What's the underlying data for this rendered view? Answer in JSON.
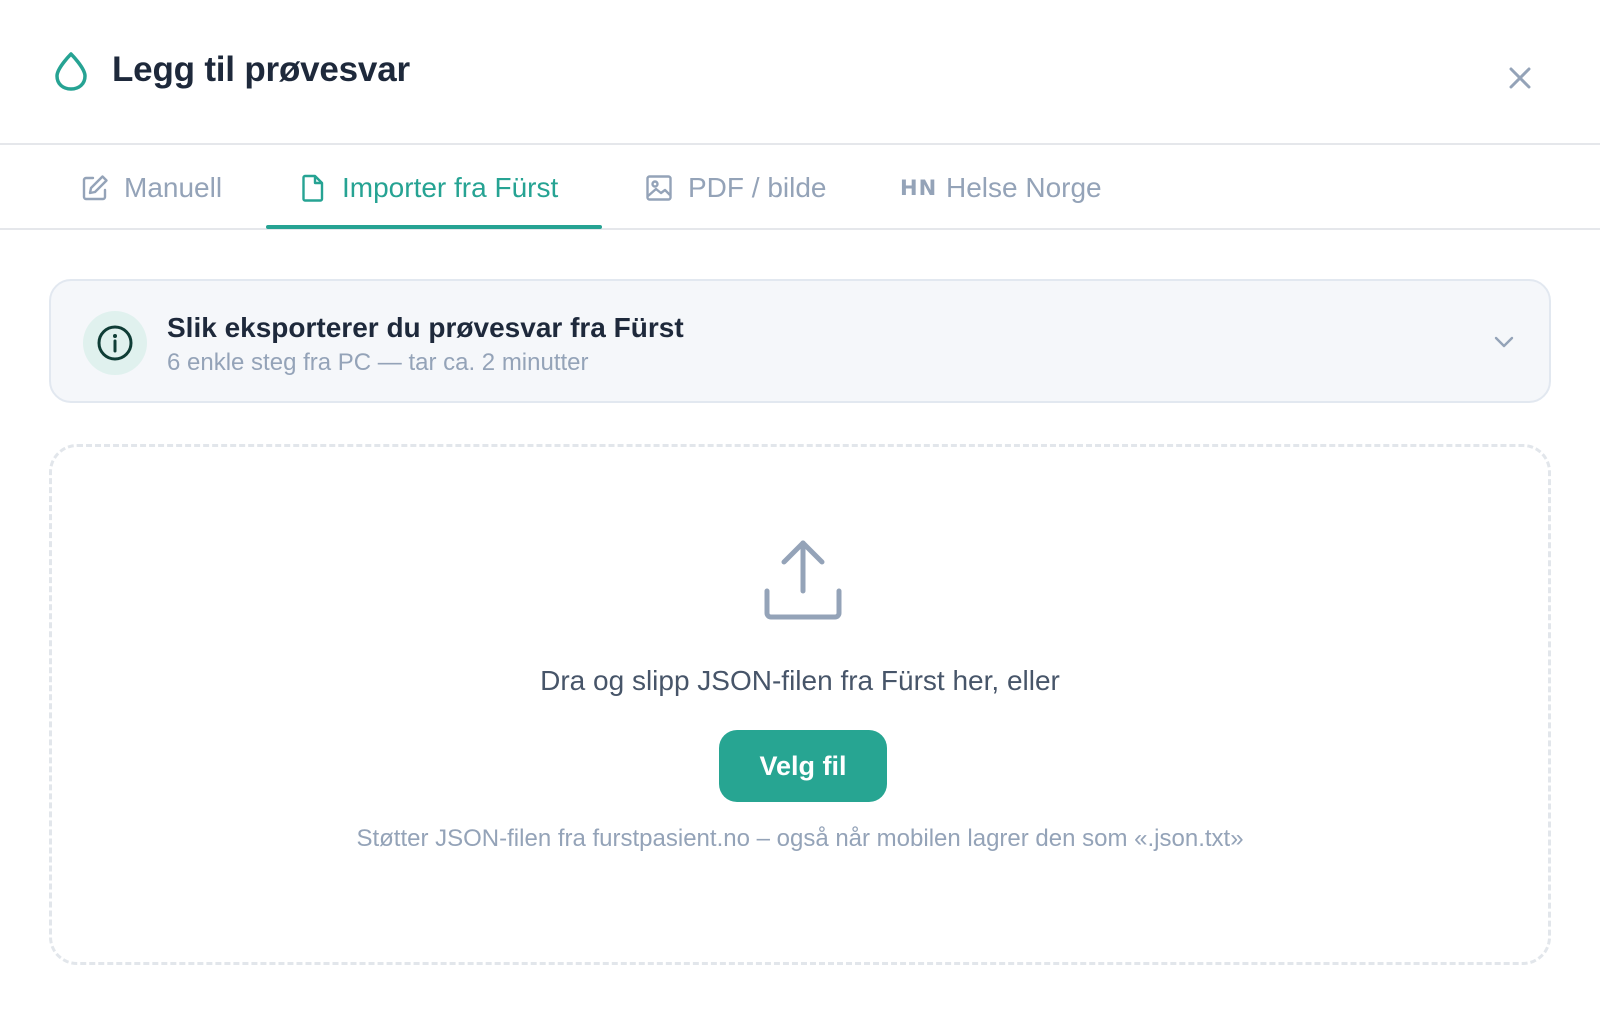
{
  "header": {
    "title": "Legg til prøvesvar",
    "icon": "water-drop-icon",
    "close_icon": "close-icon"
  },
  "tabs": [
    {
      "label": "Manuell",
      "icon": "edit-icon",
      "active": false
    },
    {
      "label": "Importer fra Fürst",
      "icon": "document-icon",
      "active": true
    },
    {
      "label": "PDF / bilde",
      "icon": "image-icon",
      "active": false
    },
    {
      "label": "Helse Norge",
      "icon": "helsenorge-logo-icon",
      "logo_text": "HN",
      "active": false
    }
  ],
  "info": {
    "title": "Slik eksporterer du prøvesvar fra Fürst",
    "subtitle": "6 enkle steg fra PC — tar ca. 2 minutter",
    "expanded": false
  },
  "dropzone": {
    "text": "Dra og slipp JSON-filen fra Fürst her, eller",
    "button_label": "Velg fil",
    "support_text": "Støtter JSON-filen fra furstpasient.no – også når mobilen lagrer den som «.json.txt»"
  },
  "colors": {
    "accent": "#26a393",
    "muted": "#94a3b8",
    "title": "#1e293b"
  }
}
